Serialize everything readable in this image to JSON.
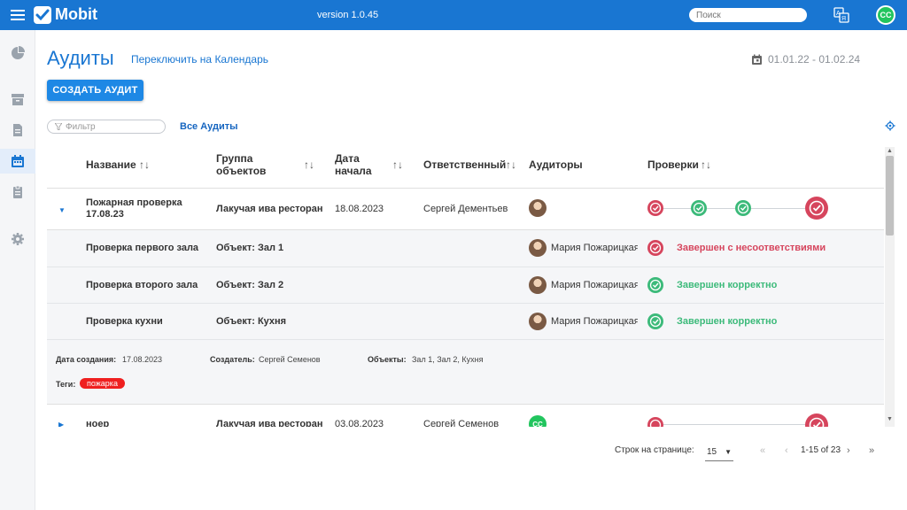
{
  "app": {
    "title": "Mobit",
    "version": "version 1.0.45"
  },
  "search": {
    "placeholder": "Поиск"
  },
  "user": {
    "initials": "CC",
    "color": "#22c55e"
  },
  "sidebar": {
    "items": [
      "dashboard-icon",
      "archive-icon",
      "document-icon",
      "calendar-icon",
      "clipboard-icon",
      "settings-icon"
    ],
    "active": "calendar-icon"
  },
  "page": {
    "title": "Аудиты",
    "switch_link": "Переключить на Календарь",
    "date_range": "01.01.22 - 01.02.24",
    "create_button": "СОЗДАТЬ АУДИТ",
    "filter_placeholder": "Фильтр",
    "all_audits": "Все Аудиты"
  },
  "table": {
    "columns": {
      "name": "Название",
      "group_line1": "Группа",
      "group_line2": "объектов",
      "date_line1": "Дата",
      "date_line2": "начала",
      "responsible": "Ответственный",
      "auditors": "Аудиторы",
      "checks": "Проверки"
    },
    "rows": [
      {
        "name_line1": "Пожарная проверка",
        "name_line2": "17.08.23",
        "group": "Лакучая ива ресторан",
        "date": "18.08.2023",
        "responsible": "Сергей Дементьев",
        "checks": [
          "error",
          "ok",
          "ok",
          "error"
        ],
        "subitems": [
          {
            "name": "Проверка первого зала",
            "object": "Объект: Зал 1",
            "auditor": "Мария Пожарицкая",
            "status": "Завершен с несоответствиями",
            "state": "error"
          },
          {
            "name": "Проверка второго зала",
            "object": "Объект: Зал 2",
            "auditor": "Мария Пожарицкая",
            "status": "Завершен корректно",
            "state": "ok"
          },
          {
            "name": "Проверка кухни",
            "object": "Объект: Кухня",
            "auditor": "Мария Пожарицкая",
            "status": "Завершен корректно",
            "state": "ok"
          }
        ],
        "meta": {
          "created_label": "Дата создания:",
          "created_value": "17.08.2023",
          "creator_label": "Создатель:",
          "creator_value": "Сергей Семенов",
          "objects_label": "Объекты:",
          "objects_value": "Зал 1, Зал 2, Кухня",
          "tags_label": "Теги:",
          "tag": "пожарка"
        }
      },
      {
        "name_line1": "ноер",
        "group": "Лакучая ива ресторан",
        "date": "03.08.2023",
        "responsible": "Сергей Семенов",
        "auditor_initials": "CC"
      }
    ]
  },
  "pagination": {
    "rows_per_page_label": "Строк на странице:",
    "rows_per_page": "15",
    "range": "1-15 of 23"
  },
  "colors": {
    "primary": "#1976d2",
    "error": "#d6455d",
    "ok": "#3cba7a",
    "tag": "#ef1f1f"
  }
}
